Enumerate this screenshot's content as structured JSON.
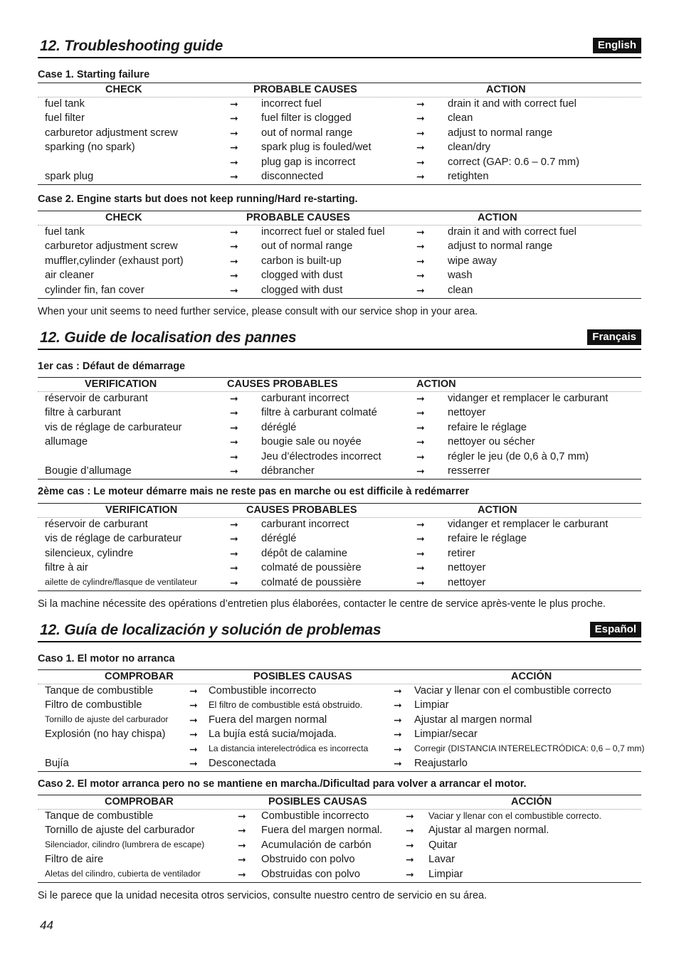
{
  "page_number": "44",
  "sections": [
    {
      "title": "12. Troubleshooting guide",
      "language": "English",
      "cases": [
        {
          "title": "Case 1. Starting failure",
          "headers": [
            "CHECK",
            "PROBABLE CAUSES",
            "ACTION"
          ],
          "rows": [
            [
              "fuel tank",
              "incorrect fuel",
              "drain it and with correct fuel"
            ],
            [
              "fuel filter",
              "fuel filter is clogged",
              "clean"
            ],
            [
              "carburetor adjustment screw",
              "out of normal range",
              "adjust to normal range"
            ],
            [
              "sparking (no spark)",
              "spark plug is fouled/wet",
              "clean/dry"
            ],
            [
              "",
              "plug gap is incorrect",
              "correct (GAP: 0.6 – 0.7 mm)"
            ],
            [
              "spark plug",
              "disconnected",
              "retighten"
            ]
          ]
        },
        {
          "title": "Case 2. Engine starts but does not keep running/Hard re-starting.",
          "headers": [
            "CHECK",
            "PROBABLE CAUSES",
            "ACTION"
          ],
          "rows": [
            [
              "fuel tank",
              "incorrect fuel or staled fuel",
              "drain it and with correct fuel"
            ],
            [
              "carburetor adjustment screw",
              "out of normal range",
              "adjust to normal range"
            ],
            [
              "muffler,cylinder (exhaust port)",
              "carbon is built-up",
              "wipe away"
            ],
            [
              "air cleaner",
              "clogged with dust",
              "wash"
            ],
            [
              "cylinder fin, fan cover",
              "clogged with dust",
              "clean"
            ]
          ]
        }
      ],
      "note": "When your unit seems to need further service, please consult with our service shop in your area."
    },
    {
      "title": "12. Guide de localisation des pannes",
      "language": "Français",
      "cases": [
        {
          "title": "1er cas : Défaut de démarrage",
          "headers": [
            "VERIFICATION",
            "CAUSES PROBABLES",
            "ACTION"
          ],
          "rows": [
            [
              "réservoir de carburant",
              "carburant incorrect",
              "vidanger et remplacer le carburant"
            ],
            [
              "filtre à carburant",
              "filtre à carburant colmaté",
              "nettoyer"
            ],
            [
              "vis de réglage de carburateur",
              "déréglé",
              "refaire le réglage"
            ],
            [
              "allumage",
              "bougie sale ou noyée",
              "nettoyer ou sécher"
            ],
            [
              "",
              "Jeu d’électrodes incorrect",
              "régler le jeu (de 0,6 à 0,7 mm)"
            ],
            [
              "Bougie d’allumage",
              "débrancher",
              "resserrer"
            ]
          ]
        },
        {
          "title": "2ème cas : Le moteur démarre mais ne reste pas en marche ou est difficile à redémarrer",
          "headers": [
            "VERIFICATION",
            "CAUSES PROBABLES",
            "ACTION"
          ],
          "rows": [
            [
              "réservoir de carburant",
              "carburant incorrect",
              "vidanger et remplacer le carburant"
            ],
            [
              "vis de réglage de carburateur",
              "déréglé",
              "refaire le réglage"
            ],
            [
              "silencieux, cylindre",
              "dépôt de calamine",
              "retirer"
            ],
            [
              "filtre à air",
              "colmaté de poussière",
              "nettoyer"
            ],
            [
              "ailette de cylindre/flasque de ventilateur",
              "colmaté  de poussière",
              "nettoyer"
            ]
          ]
        }
      ],
      "note": "Si la machine nécessite des opérations d’entretien plus élaborées, contacter le centre de service après-vente le plus proche."
    },
    {
      "title": "12. Guía de localización y solución de problemas",
      "language": "Español",
      "cases": [
        {
          "title": "Caso 1. El motor no arranca",
          "headers": [
            "COMPROBAR",
            "POSIBLES CAUSAS",
            "ACCIÓN"
          ],
          "rows": [
            [
              "Tanque de combustible",
              " Combustible incorrecto",
              "Vaciar y llenar con el combustible correcto"
            ],
            [
              "Filtro de combustible",
              "El filtro de combustible está obstruido.",
              "Limpiar"
            ],
            [
              "Tornillo de ajuste del carburador",
              "Fuera del margen normal",
              "Ajustar al margen normal"
            ],
            [
              "Explosión (no hay chispa)",
              "La bujía está sucia/mojada.",
              "Limpiar/secar"
            ],
            [
              "",
              "La distancia interelectródica es incorrecta",
              "Corregir (DISTANCIA INTERELECTRÓDICA: 0,6 – 0,7 mm)"
            ],
            [
              "Bujía",
              "Desconectada",
              "Reajustarlo"
            ]
          ]
        },
        {
          "title": "Caso 2. El motor arranca pero no se mantiene en marcha./Dificultad para volver a arrancar el motor.",
          "headers": [
            "COMPROBAR",
            "POSIBLES CAUSAS",
            "ACCIÓN"
          ],
          "rows": [
            [
              "Tanque de combustible",
              "Combustible incorrecto",
              "Vaciar y llenar con el combustible correcto."
            ],
            [
              "Tornillo de ajuste del carburador",
              "Fuera del margen normal.",
              "Ajustar al margen normal."
            ],
            [
              "Silenciador, cilindro (lumbrera de escape)",
              "Acumulación de carbón",
              "Quitar"
            ],
            [
              "Filtro de aire",
              "Obstruido con polvo",
              "Lavar"
            ],
            [
              "Aletas del cilindro, cubierta de ventilador",
              "Obstruidas con polvo",
              "Limpiar"
            ]
          ]
        }
      ],
      "note": "Si le parece que la unidad necesita otros servicios, consulte nuestro centro de servicio en su área."
    }
  ],
  "arrow_symbol": "➞"
}
